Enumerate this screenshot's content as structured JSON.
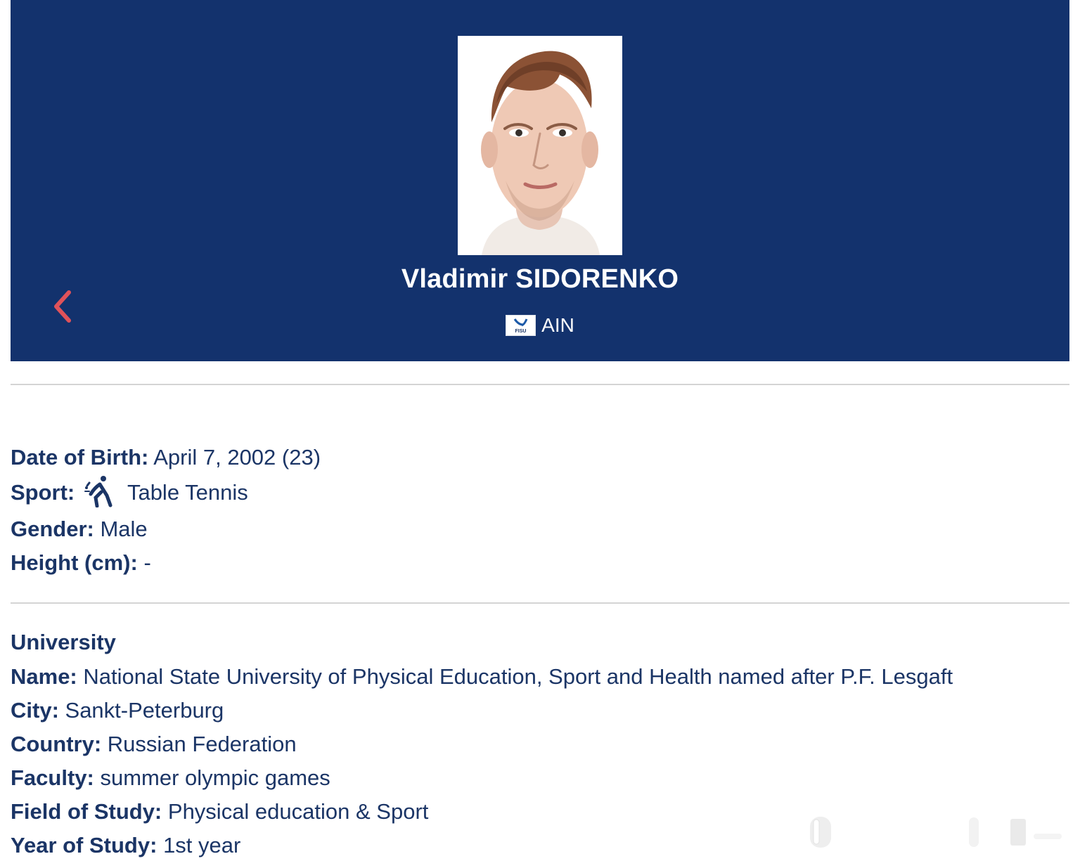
{
  "header": {
    "back_icon": "chevron-left-icon",
    "athlete_name": "Vladimir SIDORENKO",
    "country_code": "AIN",
    "flag_text": "FISU",
    "colors": {
      "header_background": "#13326d",
      "back_accent": "#e0525a",
      "text": "#1b3566"
    }
  },
  "profile": {
    "date_of_birth_label": "Date of Birth:",
    "date_of_birth_value": "April 7, 2002 (23)",
    "sport_label": "Sport:",
    "sport_icon": "table-tennis-icon",
    "sport_value": "Table Tennis",
    "gender_label": "Gender:",
    "gender_value": "Male",
    "height_label": "Height (cm):",
    "height_value": "-"
  },
  "university": {
    "title": "University",
    "name_label": "Name:",
    "name_value": "National State University of Physical Education, Sport and Health named after P.F. Lesgaft",
    "city_label": "City:",
    "city_value": "Sankt-Peterburg",
    "country_label": "Country:",
    "country_value": "Russian Federation",
    "faculty_label": "Faculty:",
    "faculty_value": "summer olympic games",
    "field_label": "Field of Study:",
    "field_value": "Physical education & Sport",
    "year_label": "Year of Study:",
    "year_value": "1st year"
  }
}
